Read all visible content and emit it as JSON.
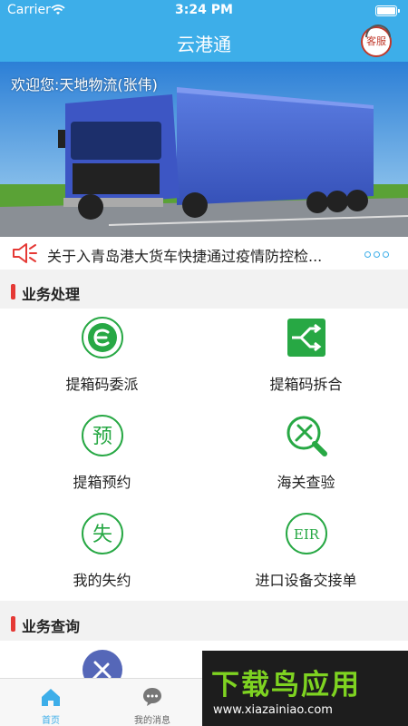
{
  "status_bar": {
    "carrier": "Carrier",
    "time": "3:24 PM"
  },
  "nav": {
    "title": "云港通",
    "customer_service": "客服"
  },
  "banner": {
    "welcome": "欢迎您:天地物流(张伟)"
  },
  "notice": {
    "text": "关于入青岛港大货车快捷通过疫情防控检..."
  },
  "sections": [
    {
      "title": "业务处理"
    },
    {
      "title": "业务查询"
    }
  ],
  "business_items": [
    {
      "label": "提箱码委派",
      "icon": "dispatch-e-icon"
    },
    {
      "label": "提箱码拆合",
      "icon": "split-merge-icon"
    },
    {
      "label": "提箱预约",
      "icon": "reserve-icon",
      "glyph": "预"
    },
    {
      "label": "海关查验",
      "icon": "customs-inspect-icon"
    },
    {
      "label": "我的失约",
      "icon": "missed-icon",
      "glyph": "失"
    },
    {
      "label": "进口设备交接单",
      "icon": "eir-icon",
      "glyph": "EIR"
    }
  ],
  "tabs": [
    {
      "label": "首页",
      "icon": "home-icon",
      "active": true
    },
    {
      "label": "我的消息",
      "icon": "message-icon",
      "active": false
    }
  ],
  "watermark": {
    "logo": "下载鸟应用",
    "url": "www.xiazainiao.com"
  },
  "colors": {
    "primary": "#3daee9",
    "accent_green": "#27a844",
    "section_marker": "#e53935"
  }
}
